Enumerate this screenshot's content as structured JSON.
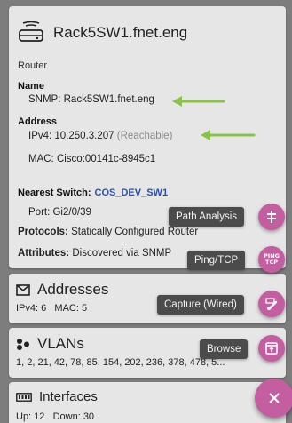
{
  "device": {
    "name": "Rack5SW1.fnet.eng",
    "type": "Router",
    "name_label": "Name",
    "snmp": "SNMP: Rack5SW1.fnet.eng",
    "address_label": "Address",
    "ipv4": "IPv4: 10.250.3.207",
    "ipv4_status": "(Reachable)",
    "mac": "MAC: Cisco:00141c-8945c1",
    "nearest_label": "Nearest Switch:",
    "nearest_value": "COS_DEV_SW1",
    "port": "Port: Gi2/0/39",
    "protocols_label": "Protocols:",
    "protocols_value": "Statically Configured Router",
    "attributes_label": "Attributes:",
    "attributes_value": "Discovered via SNMP",
    "attributes_tail": "S"
  },
  "addresses": {
    "title": "Addresses",
    "summary": "IPv4: 6   MAC: 5"
  },
  "vlans": {
    "title": "VLANs",
    "summary": "1, 2, 21, 42, 78, 85, 154, 202, 236, 378, 478, 5..."
  },
  "interfaces": {
    "title": "Interfaces",
    "summary": "Up: 12   Down: 30"
  },
  "fab_menu": {
    "path_analysis": "Path Analysis",
    "ping_tcp": "Ping/TCP",
    "capture_wired": "Capture (Wired)",
    "browse": "Browse",
    "ping_icon_line1": "PING",
    "ping_icon_line2": "TCP"
  },
  "colors": {
    "fab": "#c35ea0",
    "arrow": "#8bc34a",
    "link": "#2a4fb3",
    "overlay": "#7d7d7d"
  }
}
